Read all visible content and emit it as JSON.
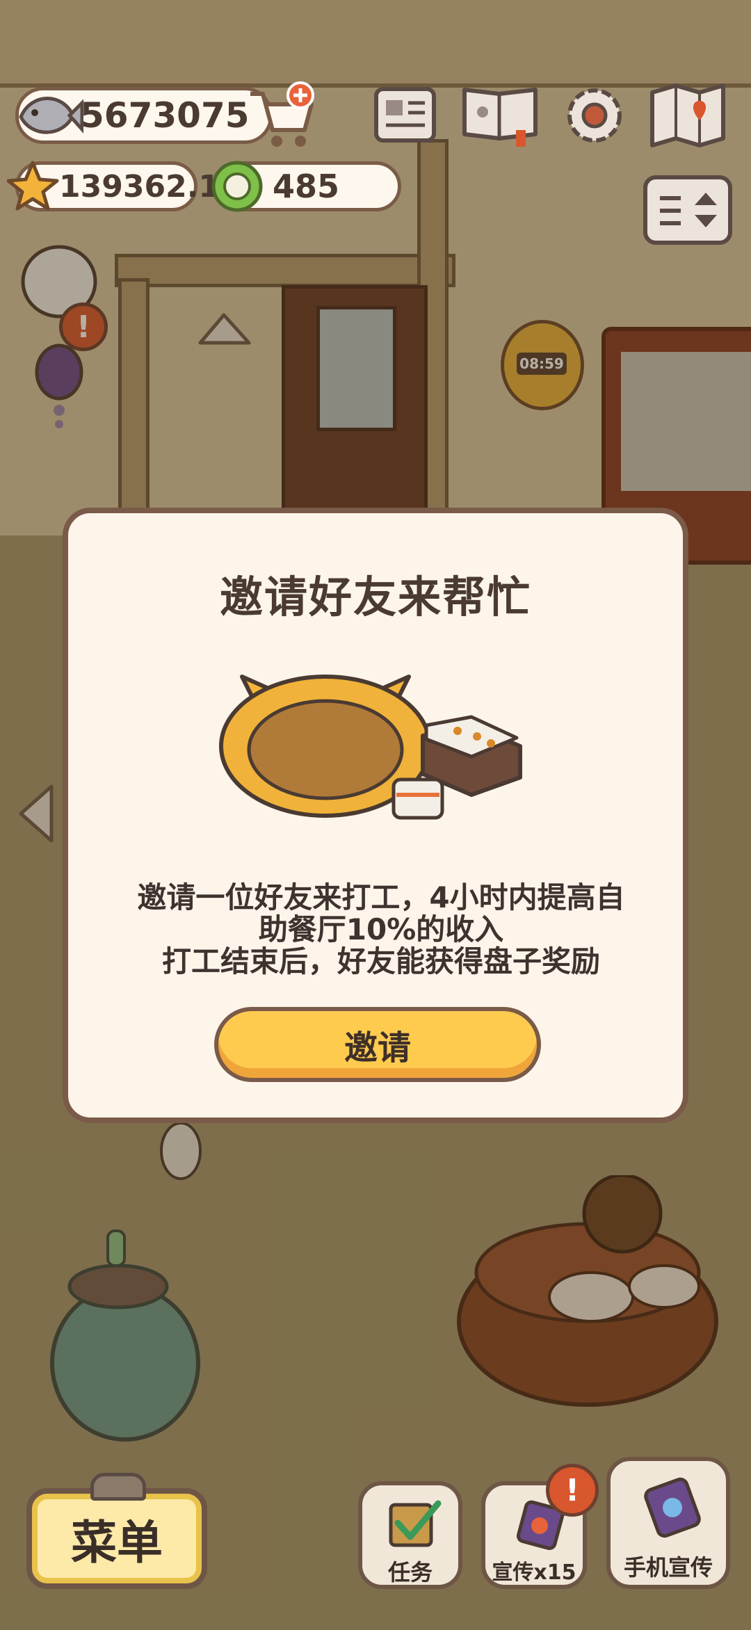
{
  "currency": {
    "fish": "5673075",
    "stars": "139362.1",
    "plates": "485"
  },
  "dialog": {
    "title": "邀请好友来帮忙",
    "body_line1": "邀请一位好友来打工，4小时内提高自",
    "body_line2": "助餐厅10%的收入",
    "body_line3": "打工结束后，好友能获得盘子奖励",
    "invite_label": "邀请"
  },
  "scene": {
    "timer": "08:59"
  },
  "bottom_bar": {
    "menu_label": "菜单",
    "tasks_label": "任务",
    "promo_label": "宣传x15",
    "phone_promo_label": "手机宣传",
    "badge": "!"
  },
  "colors": {
    "accent_yellow": "#fecb4f",
    "outline_brown": "#7a5a48",
    "alert_red": "#d9572e"
  }
}
